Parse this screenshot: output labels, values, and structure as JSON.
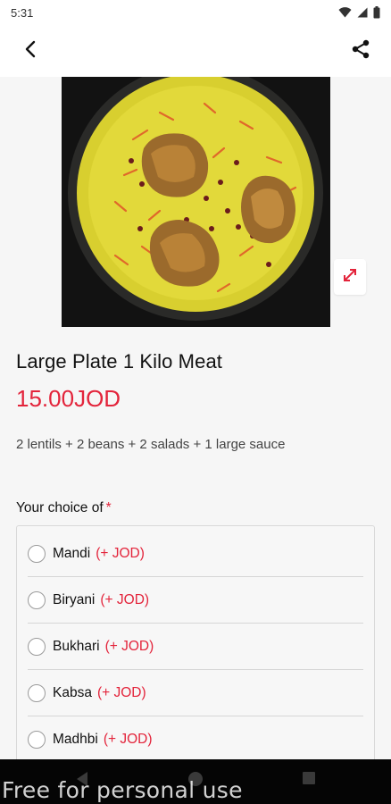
{
  "status_bar": {
    "time": "5:31",
    "icons": [
      "wifi-icon",
      "signal-icon",
      "battery-icon"
    ]
  },
  "app_bar": {
    "back_icon": "arrow-back-icon",
    "share_icon": "share-icon"
  },
  "product": {
    "image_icon": "food-plate-image",
    "expand_icon": "expand-icon",
    "title": "Large Plate 1 Kilo Meat",
    "price": "15.00JOD",
    "description": "2 lentils + 2 beans + 2 salads + 1 large sauce"
  },
  "choices": {
    "label": "Your choice of",
    "required_mark": "*",
    "options": [
      {
        "name": "Mandi",
        "extra": "(+ JOD)"
      },
      {
        "name": "Biryani",
        "extra": "(+ JOD)"
      },
      {
        "name": "Bukhari",
        "extra": "(+ JOD)"
      },
      {
        "name": "Kabsa",
        "extra": "(+ JOD)"
      },
      {
        "name": "Madhbi",
        "extra": "(+ JOD)"
      }
    ]
  },
  "watermark": "Free for personal use",
  "colors": {
    "accent": "#e3243b",
    "background": "#f6f6f6"
  }
}
